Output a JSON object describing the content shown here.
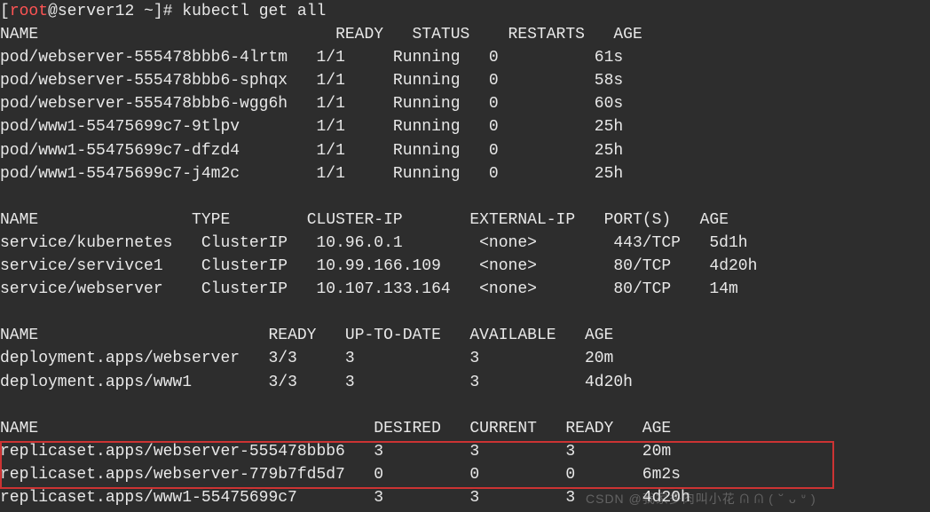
{
  "prompt": {
    "open": "[",
    "user": "root",
    "at": "@",
    "host": "server12",
    "path": " ~",
    "close": "]#",
    "command": "kubectl get all"
  },
  "pods": {
    "headers": [
      "NAME",
      "READY",
      "STATUS",
      "RESTARTS",
      "AGE"
    ],
    "rows": [
      {
        "name": "pod/webserver-555478bbb6-4lrtm",
        "ready": "1/1",
        "status": "Running",
        "restarts": "0",
        "age": "61s"
      },
      {
        "name": "pod/webserver-555478bbb6-sphqx",
        "ready": "1/1",
        "status": "Running",
        "restarts": "0",
        "age": "58s"
      },
      {
        "name": "pod/webserver-555478bbb6-wgg6h",
        "ready": "1/1",
        "status": "Running",
        "restarts": "0",
        "age": "60s"
      },
      {
        "name": "pod/www1-55475699c7-9tlpv",
        "ready": "1/1",
        "status": "Running",
        "restarts": "0",
        "age": "25h"
      },
      {
        "name": "pod/www1-55475699c7-dfzd4",
        "ready": "1/1",
        "status": "Running",
        "restarts": "0",
        "age": "25h"
      },
      {
        "name": "pod/www1-55475699c7-j4m2c",
        "ready": "1/1",
        "status": "Running",
        "restarts": "0",
        "age": "25h"
      }
    ]
  },
  "services": {
    "headers": [
      "NAME",
      "TYPE",
      "CLUSTER-IP",
      "EXTERNAL-IP",
      "PORT(S)",
      "AGE"
    ],
    "rows": [
      {
        "name": "service/kubernetes",
        "type": "ClusterIP",
        "cluster_ip": "10.96.0.1",
        "external_ip": "<none>",
        "ports": "443/TCP",
        "age": "5d1h"
      },
      {
        "name": "service/servivce1",
        "type": "ClusterIP",
        "cluster_ip": "10.99.166.109",
        "external_ip": "<none>",
        "ports": "80/TCP",
        "age": "4d20h"
      },
      {
        "name": "service/webserver",
        "type": "ClusterIP",
        "cluster_ip": "10.107.133.164",
        "external_ip": "<none>",
        "ports": "80/TCP",
        "age": "14m"
      }
    ]
  },
  "deployments": {
    "headers": [
      "NAME",
      "READY",
      "UP-TO-DATE",
      "AVAILABLE",
      "AGE"
    ],
    "rows": [
      {
        "name": "deployment.apps/webserver",
        "ready": "3/3",
        "uptodate": "3",
        "available": "3",
        "age": "20m"
      },
      {
        "name": "deployment.apps/www1",
        "ready": "3/3",
        "uptodate": "3",
        "available": "3",
        "age": "4d20h"
      }
    ]
  },
  "replicasets": {
    "headers": [
      "NAME",
      "DESIRED",
      "CURRENT",
      "READY",
      "AGE"
    ],
    "rows": [
      {
        "name": "replicaset.apps/webserver-555478bbb6",
        "desired": "3",
        "current": "3",
        "ready": "3",
        "age": "20m"
      },
      {
        "name": "replicaset.apps/webserver-779b7fd5d7",
        "desired": "0",
        "current": "0",
        "ready": "0",
        "age": "6m2s"
      },
      {
        "name": "replicaset.apps/www1-55475699c7",
        "desired": "3",
        "current": "3",
        "ready": "3",
        "age": "4d20h"
      }
    ]
  },
  "watermark": "CSDN @我家多肉叫小花 ᕬ ᕬ ( ᐡ ᴗ ᐡ )"
}
